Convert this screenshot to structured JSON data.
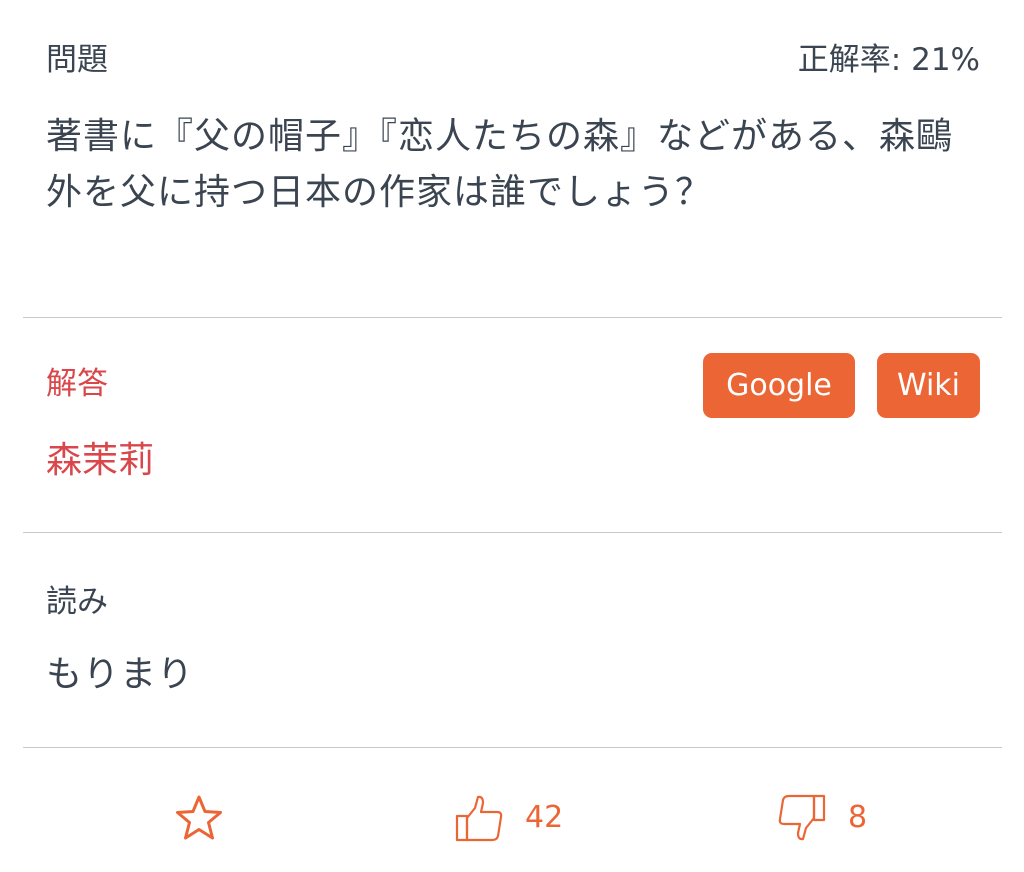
{
  "question": {
    "label": "問題",
    "accuracy": "正解率: 21%",
    "text": "著書に『父の帽子』『恋人たちの森』などがある、森鷗外を父に持つ日本の作家は誰でしょう？"
  },
  "answer": {
    "label": "解答",
    "text": "森茉莉",
    "google_label": "Google",
    "wiki_label": "Wiki"
  },
  "reading": {
    "label": "読み",
    "text": "もりまり"
  },
  "actions": {
    "like_count": "42",
    "dislike_count": "8",
    "icons": [
      "star-icon",
      "thumbs-up-icon",
      "thumbs-down-icon"
    ]
  },
  "colors": {
    "accent": "#ec6535",
    "answer": "#d9474b",
    "text": "#3b4552",
    "divider": "#c8c8cc"
  }
}
